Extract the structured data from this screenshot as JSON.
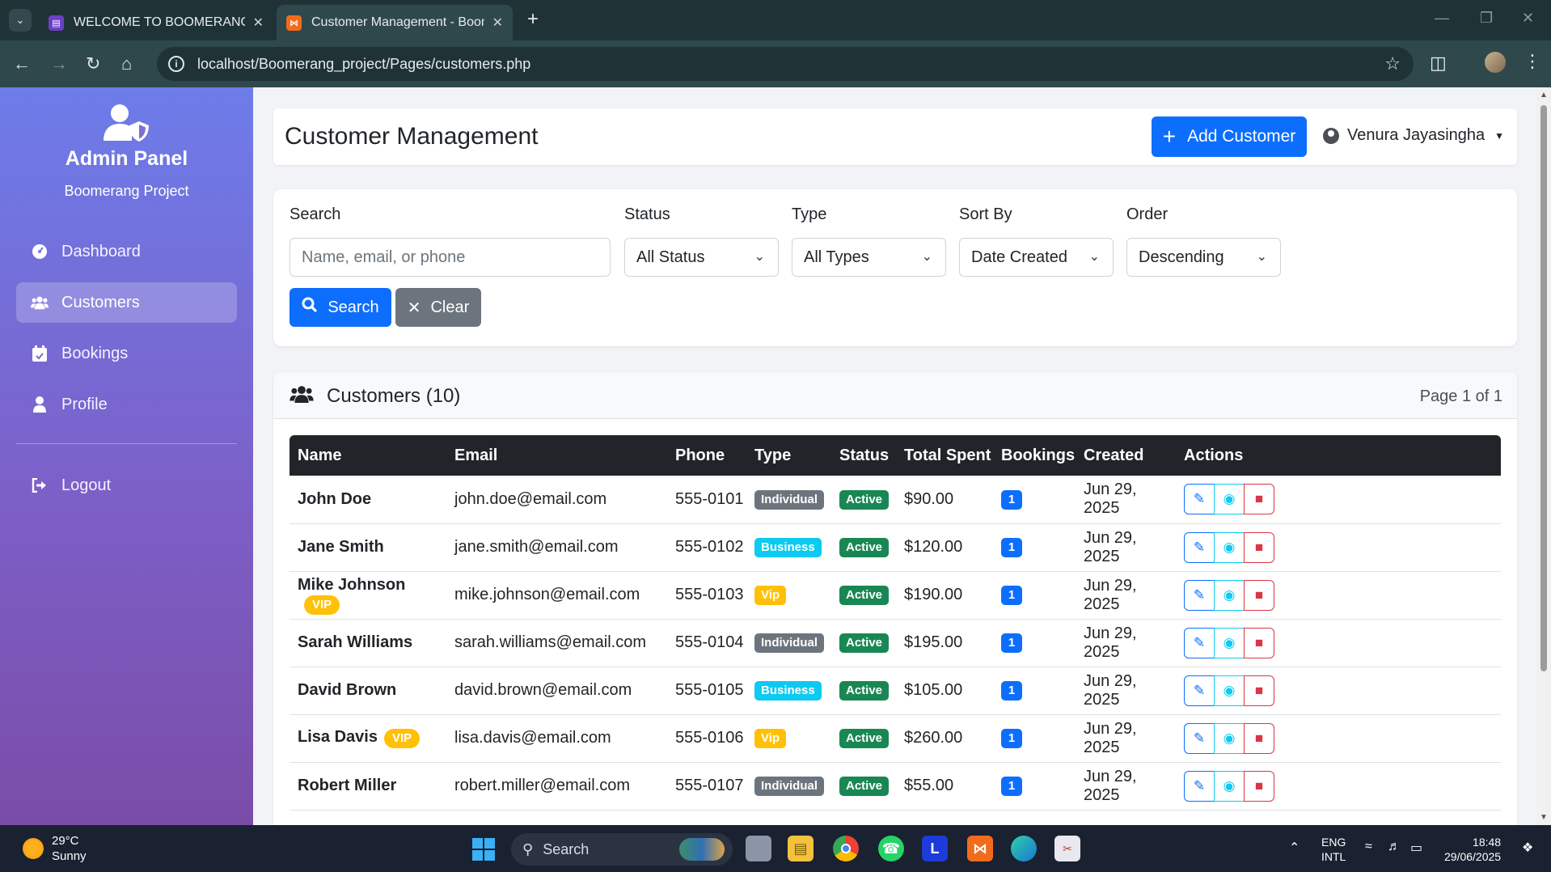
{
  "browser": {
    "tabs": [
      {
        "title": "WELCOME TO BOOMERANG SC",
        "favicon": "purple-square-icon"
      },
      {
        "title": "Customer Management - Boom",
        "favicon": "xampp-icon"
      }
    ],
    "url": "localhost/Boomerang_project/Pages/customers.php"
  },
  "sidebar": {
    "title": "Admin Panel",
    "subtitle": "Boomerang Project",
    "items": [
      {
        "label": "Dashboard",
        "icon": "tachometer-icon",
        "active": false
      },
      {
        "label": "Customers",
        "icon": "users-icon",
        "active": true
      },
      {
        "label": "Bookings",
        "icon": "calendar-icon",
        "active": false
      },
      {
        "label": "Profile",
        "icon": "user-icon",
        "active": false
      }
    ],
    "logout": {
      "label": "Logout",
      "icon": "sign-out-icon"
    }
  },
  "header": {
    "title": "Customer Management",
    "add_label": "Add Customer",
    "user_name": "Venura Jayasingha"
  },
  "filters": {
    "search_label": "Search",
    "search_placeholder": "Name, email, or phone",
    "status_label": "Status",
    "status_value": "All Status",
    "type_label": "Type",
    "type_value": "All Types",
    "sort_label": "Sort By",
    "sort_value": "Date Created",
    "order_label": "Order",
    "order_value": "Descending",
    "search_button": "Search",
    "clear_button": "Clear"
  },
  "table": {
    "title": "Customers (10)",
    "page_info": "Page 1 of 1",
    "columns": [
      "Name",
      "Email",
      "Phone",
      "Type",
      "Status",
      "Total Spent",
      "Bookings",
      "Created",
      "Actions"
    ],
    "vip_tag": "VIP",
    "rows": [
      {
        "name": "John Doe",
        "vip": false,
        "email": "john.doe@email.com",
        "phone": "555-0101",
        "type": "Individual",
        "status": "Active",
        "spent": "$90.00",
        "bookings": "1",
        "created": "Jun 29, 2025"
      },
      {
        "name": "Jane Smith",
        "vip": false,
        "email": "jane.smith@email.com",
        "phone": "555-0102",
        "type": "Business",
        "status": "Active",
        "spent": "$120.00",
        "bookings": "1",
        "created": "Jun 29, 2025"
      },
      {
        "name": "Mike Johnson",
        "vip": true,
        "email": "mike.johnson@email.com",
        "phone": "555-0103",
        "type": "Vip",
        "status": "Active",
        "spent": "$190.00",
        "bookings": "1",
        "created": "Jun 29, 2025"
      },
      {
        "name": "Sarah Williams",
        "vip": false,
        "email": "sarah.williams@email.com",
        "phone": "555-0104",
        "type": "Individual",
        "status": "Active",
        "spent": "$195.00",
        "bookings": "1",
        "created": "Jun 29, 2025"
      },
      {
        "name": "David Brown",
        "vip": false,
        "email": "david.brown@email.com",
        "phone": "555-0105",
        "type": "Business",
        "status": "Active",
        "spent": "$105.00",
        "bookings": "1",
        "created": "Jun 29, 2025"
      },
      {
        "name": "Lisa Davis",
        "vip": true,
        "email": "lisa.davis@email.com",
        "phone": "555-0106",
        "type": "Vip",
        "status": "Active",
        "spent": "$260.00",
        "bookings": "1",
        "created": "Jun 29, 2025"
      },
      {
        "name": "Robert Miller",
        "vip": false,
        "email": "robert.miller@email.com",
        "phone": "555-0107",
        "type": "Individual",
        "status": "Active",
        "spent": "$55.00",
        "bookings": "1",
        "created": "Jun 29, 2025"
      }
    ]
  },
  "taskbar": {
    "temp": "29°C",
    "weather": "Sunny",
    "search": "Search",
    "lang1": "ENG",
    "lang2": "INTL",
    "time": "18:48",
    "date": "29/06/2025"
  },
  "colors": {
    "primary": "#0d6efd",
    "secondary": "#6c757d",
    "success": "#198754",
    "info": "#0dcaf0",
    "warning": "#ffc107",
    "danger": "#dc3545",
    "sidebar_top": "#6d7ce9",
    "sidebar_bottom": "#7a4ca8"
  }
}
